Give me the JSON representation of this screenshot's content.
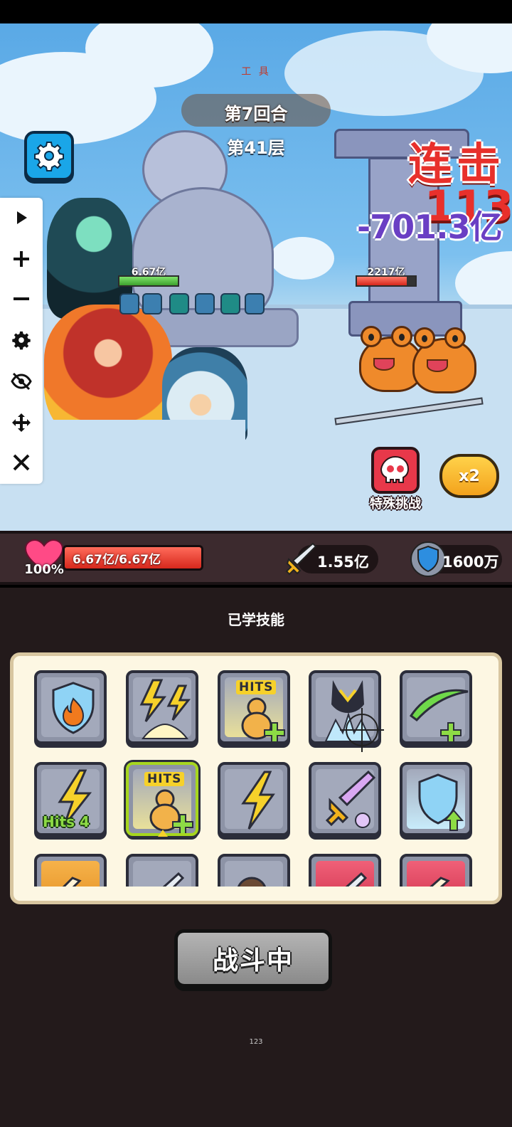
{
  "top_caption": "工 具",
  "battle": {
    "round": "第7回合",
    "floor": "第41层",
    "combo_label": "连击",
    "combo_count": "113",
    "damage": "-701.3亿",
    "team_hp_label": "6.67亿",
    "team_hp_fraction": 1.0,
    "enemy_hp_label": "2217亿",
    "enemy_hp_fraction": 0.85
  },
  "floating_controls": [
    {
      "icon": "play-icon"
    },
    {
      "icon": "plus-icon"
    },
    {
      "icon": "minus-icon"
    },
    {
      "icon": "gear-icon"
    },
    {
      "icon": "eye-off-icon"
    },
    {
      "icon": "move-icon"
    },
    {
      "icon": "close-icon"
    }
  ],
  "special_challenge_label": "特殊挑战",
  "speed_label": "x2",
  "stats": {
    "hp_percent": "100%",
    "hp_text": "6.67亿/6.67亿",
    "hp_fraction": 1.0,
    "attack": "1.55亿",
    "defense": "1600万"
  },
  "skills": {
    "title": "已学技能",
    "hits_tag": "HITS",
    "hits4_tag": "Hits 4",
    "tiles": [
      {
        "icon": "fire-shield-icon"
      },
      {
        "icon": "lightning-burst-icon"
      },
      {
        "icon": "gourd-hits-plus-icon"
      },
      {
        "icon": "ice-claw-icon"
      },
      {
        "icon": "slash-plus-icon"
      },
      {
        "icon": "lightning-hits4-icon"
      },
      {
        "icon": "gourd-hits-plus-selected-icon"
      },
      {
        "icon": "lightning-icon"
      },
      {
        "icon": "skull-sword-icon"
      },
      {
        "icon": "shield-up-icon"
      },
      {
        "icon": "flame-sword-icon"
      },
      {
        "icon": "sword-icon"
      },
      {
        "icon": "warrior-icon"
      },
      {
        "icon": "red-sword-icon"
      },
      {
        "icon": "red-flame-sword-icon"
      }
    ]
  },
  "fight_button": "战斗中",
  "footer_small": "123",
  "colors": {
    "accent_blue": "#1aa6e8",
    "combo_red": "#e8302b",
    "damage_purple": "#6a3fc4",
    "hp_red": "#d6281d",
    "selected_green": "#a7d61e"
  }
}
